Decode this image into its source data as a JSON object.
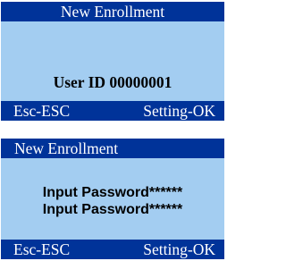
{
  "screens": [
    {
      "title": "New Enrollment",
      "message": "User ID 00000001",
      "softkeys": {
        "left": "Esc-ESC",
        "right": "Setting-OK"
      }
    },
    {
      "title": "New Enrollment",
      "messages": [
        "Input Password******",
        "Input Password******"
      ],
      "softkeys": {
        "left": "Esc-ESC",
        "right": "Setting-OK"
      }
    }
  ],
  "colors": {
    "screen_bg": "#a3cdf1",
    "bar_bg": "#003399",
    "bar_text": "#ffffff",
    "body_text": "#000000"
  }
}
